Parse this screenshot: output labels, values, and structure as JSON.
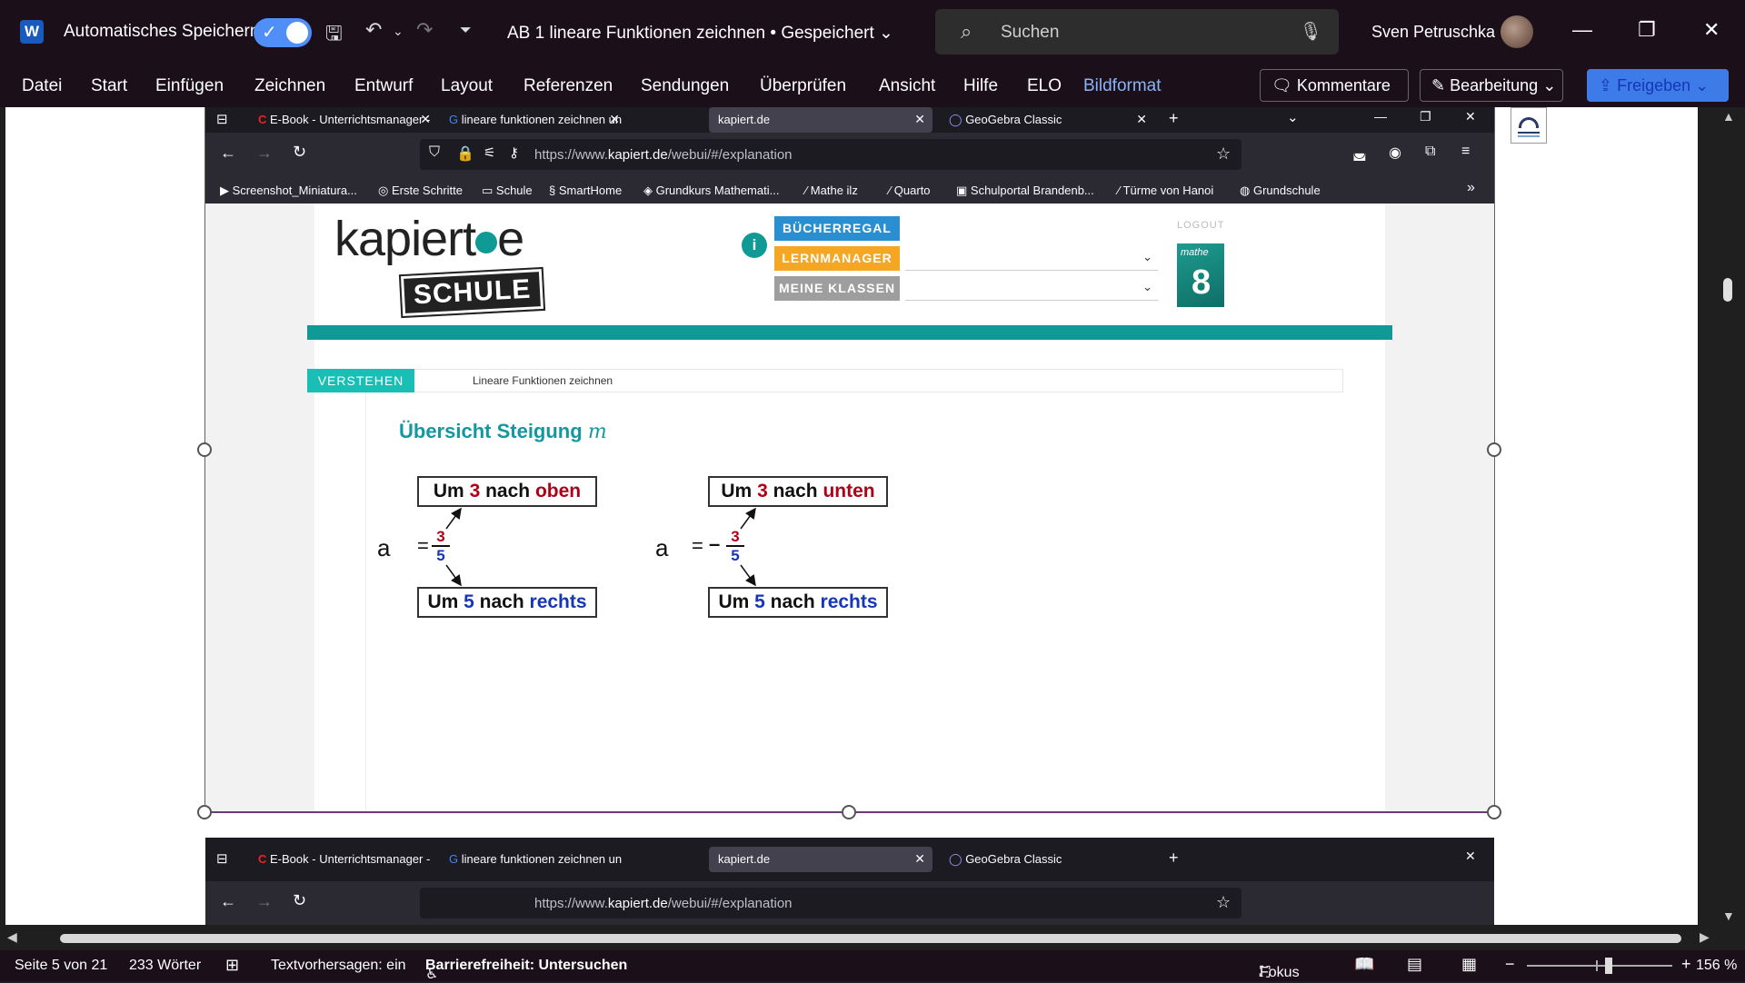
{
  "word": {
    "logo_letter": "W",
    "autosave_label": "Automatisches Speichern",
    "doc_title": "AB 1 lineare Funktionen zeichnen • Gespeichert",
    "search_placeholder": "Suchen",
    "user_name": "Sven Petruschka",
    "menu": [
      "Datei",
      "Start",
      "Einfügen",
      "Zeichnen",
      "Entwurf",
      "Layout",
      "Referenzen",
      "Sendungen",
      "Überprüfen",
      "Ansicht",
      "Hilfe",
      "ELO",
      "Bildformat"
    ],
    "comments_label": "Kommentare",
    "edit_label": "Bearbeitung",
    "share_label": "Freigeben",
    "status": {
      "page": "Seite 5 von 21",
      "words": "233 Wörter",
      "predictions": "Textvorhersagen: ein",
      "accessibility": "Barrierefreiheit: Untersuchen",
      "focus": "Fokus",
      "zoom": "156 %"
    }
  },
  "firefox": {
    "tabs": [
      {
        "label": "E-Book - Unterrichtsmanager -",
        "active": false
      },
      {
        "label": "lineare funktionen zeichnen un",
        "active": false
      },
      {
        "label": "kapiert.de",
        "active": true
      },
      {
        "label": "GeoGebra Classic",
        "active": false
      }
    ],
    "url_prefix": "https://www.",
    "url_domain": "kapiert.de",
    "url_path": "/webui/#/explanation",
    "bookmarks": [
      "Screenshot_Miniatura...",
      "Erste Schritte",
      "Schule",
      "SmartHome",
      "Grundkurs Mathemati...",
      "Mathe ilz",
      "Quarto",
      "Schulportal Brandenb...",
      "Türme von Hanoi",
      "Grundschule"
    ]
  },
  "kapiert": {
    "logo_text_a": "kapiert",
    "logo_text_b": "e",
    "schule": "SCHULE",
    "info_icon": "i",
    "btn_bookshelf": "BÜCHERREGAL",
    "btn_learnmanager": "LERNMANAGER",
    "btn_classes": "MEINE KLASSEN",
    "logout": "LOGOUT",
    "book_series": "mathe",
    "book_grade": "8",
    "tab_label": "VERSTEHEN",
    "tab_title": "Lineare Funktionen zeichnen",
    "heading": "Übersicht Steigung",
    "heading_var": "m",
    "left": {
      "top_a": "Um",
      "top_num": "3",
      "top_b": "nach",
      "top_dir": "oben",
      "bottom_a": "Um",
      "bottom_num": "5",
      "bottom_b": "nach",
      "bottom_dir": "rechts",
      "var": "a",
      "eq": "=",
      "sign": "",
      "numerator": "3",
      "denominator": "5"
    },
    "right": {
      "top_a": "Um",
      "top_num": "3",
      "top_b": "nach",
      "top_dir": "unten",
      "bottom_a": "Um",
      "bottom_num": "5",
      "bottom_b": "nach",
      "bottom_dir": "rechts",
      "var": "a",
      "eq": "=",
      "sign": "–",
      "numerator": "3",
      "denominator": "5"
    }
  },
  "colors": {
    "teal": "#0f9a95",
    "up_red": "#b00018",
    "right_blue": "#1636b8",
    "minus_orange": "#f07a12",
    "bookshelf": "#2a8fd0",
    "learnmanager": "#f5a623",
    "classes": "#9e9e9e",
    "word_accent": "#3d7be8"
  }
}
